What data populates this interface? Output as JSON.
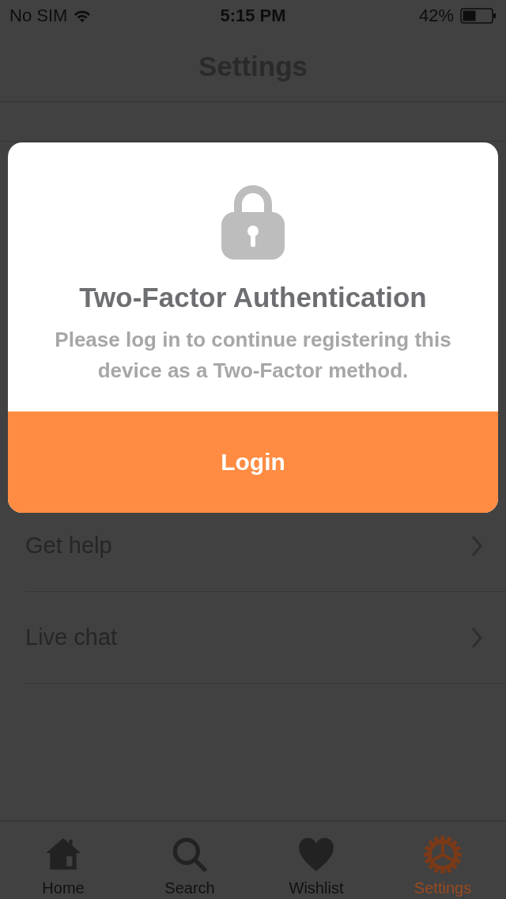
{
  "status_bar": {
    "carrier": "No SIM",
    "time": "5:15 PM",
    "battery": "42%"
  },
  "nav_bar": {
    "title": "Settings"
  },
  "rows": [
    {
      "label": "Get help"
    },
    {
      "label": "Live chat"
    }
  ],
  "dialog": {
    "title": "Two-Factor Authentication",
    "message": "Please log in to continue registering this device as a Two-Factor method.",
    "button": "Login"
  },
  "tab_bar": [
    {
      "label": "Home",
      "selected": false
    },
    {
      "label": "Search",
      "selected": false
    },
    {
      "label": "Wishlist",
      "selected": false
    },
    {
      "label": "Settings",
      "selected": true
    }
  ]
}
